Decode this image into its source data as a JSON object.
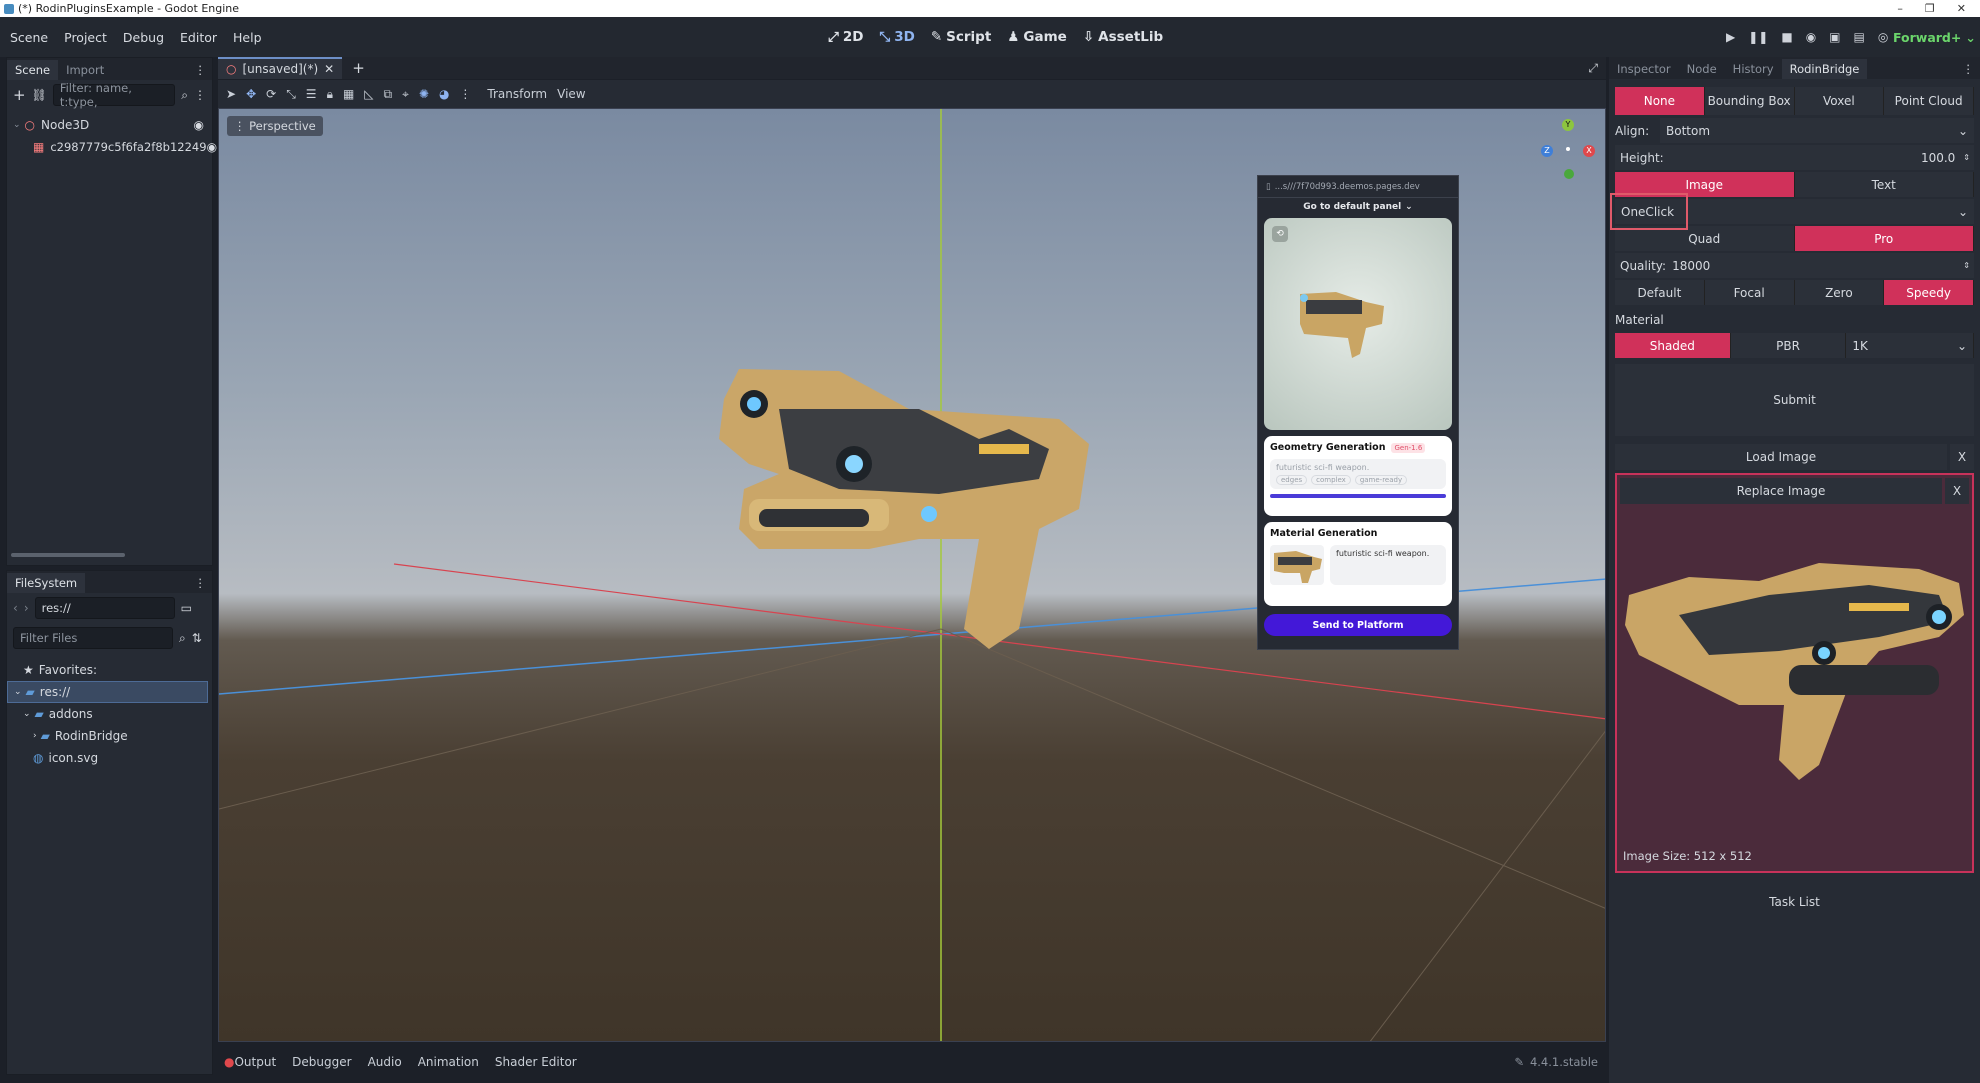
{
  "window": {
    "title": "(*) RodinPluginsExample - Godot Engine",
    "controls": [
      "–",
      "❐",
      "✕"
    ]
  },
  "menu": [
    "Scene",
    "Project",
    "Debug",
    "Editor",
    "Help"
  ],
  "main_screens": [
    {
      "label": "2D",
      "icon": "2d-icon"
    },
    {
      "label": "3D",
      "icon": "3d-icon"
    },
    {
      "label": "Script",
      "icon": "script-icon"
    },
    {
      "label": "Game",
      "icon": "game-icon"
    },
    {
      "label": "AssetLib",
      "icon": "assetlib-icon"
    }
  ],
  "renderer": "Forward+",
  "scene_dock": {
    "tabs": [
      "Scene",
      "Import"
    ],
    "filter_placeholder": "Filter: name, t:type,",
    "nodes": [
      {
        "name": "Node3D"
      },
      {
        "name": "c2987779c5f6fa2f8b12249"
      }
    ]
  },
  "filesystem_dock": {
    "title": "FileSystem",
    "path": "res://",
    "filter_placeholder": "Filter Files",
    "favorites": "Favorites:",
    "items": [
      {
        "name": "res://"
      },
      {
        "name": "addons"
      },
      {
        "name": "RodinBridge"
      },
      {
        "name": "icon.svg"
      }
    ]
  },
  "editor_tabs": {
    "scene_tab": "[unsaved](*)",
    "add": "+"
  },
  "viewport_toolbar": {
    "transform": "Transform",
    "view": "View"
  },
  "viewport": {
    "perspective_label": "Perspective"
  },
  "gizmo": {
    "y": "Y",
    "z": "Z",
    "x": "X"
  },
  "web_panel": {
    "url": "...s///7f70d993.deemos.pages.dev",
    "default_panel": "Go to default panel",
    "geometry": {
      "title": "Geometry Generation",
      "badge": "Gen-1.6",
      "prompt": "futuristic sci-fi weapon.",
      "tags": [
        "edges",
        "complex",
        "game-ready"
      ]
    },
    "material": {
      "title": "Material Generation",
      "prompt": "futuristic sci-fi weapon."
    },
    "send_button": "Send to Platform"
  },
  "bottom_panel": {
    "tabs": [
      "Output",
      "Debugger",
      "Audio",
      "Animation",
      "Shader Editor"
    ],
    "version": "4.4.1.stable"
  },
  "right_dock": {
    "tabs": [
      "Inspector",
      "Node",
      "History",
      "RodinBridge"
    ],
    "mode_options": [
      "None",
      "Bounding Box",
      "Voxel",
      "Point Cloud"
    ],
    "align_label": "Align:",
    "align_value": "Bottom",
    "height_label": "Height:",
    "height_value": "100.0",
    "input_tabs": [
      "Image",
      "Text"
    ],
    "tier_value": "OneClick",
    "mesh_options": [
      "Quad",
      "Pro"
    ],
    "quality_label": "Quality:",
    "quality_value": "18000",
    "style_options": [
      "Default",
      "Focal",
      "Zero",
      "Speedy"
    ],
    "material_label": "Material",
    "material_options": [
      "Shaded",
      "PBR"
    ],
    "resolution_value": "1K",
    "submit": "Submit",
    "load_image": "Load Image",
    "replace_image": "Replace Image",
    "close": "X",
    "image_size": "Image Size: 512 x 512",
    "task_list": "Task List",
    "accent": "#d0315a"
  }
}
